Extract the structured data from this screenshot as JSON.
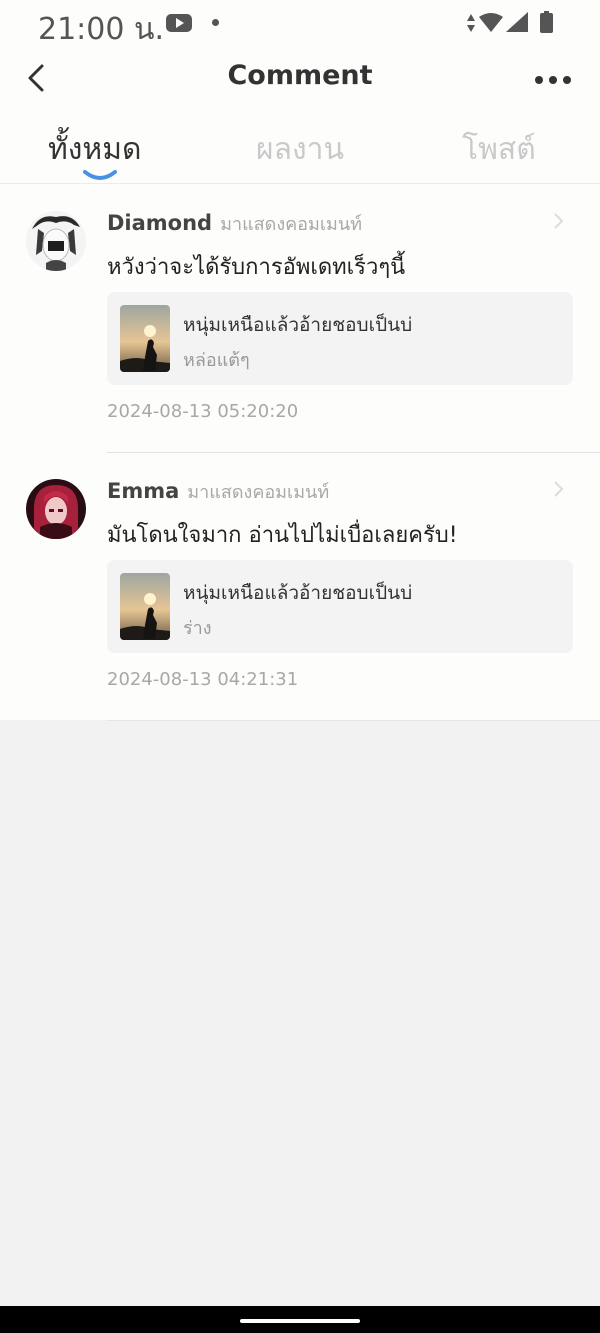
{
  "status_bar": {
    "time": "21:00 น.",
    "icons": [
      "youtube-icon",
      "dot-icon",
      "data-arrows-icon",
      "wifi-icon",
      "signal-icon",
      "battery-icon"
    ]
  },
  "header": {
    "title": "Comment",
    "back_icon": "chevron-left-icon",
    "more_icon": "more-horizontal-icon"
  },
  "tabs": [
    {
      "label": "ทั้งหมด",
      "active": true
    },
    {
      "label": "ผลงาน",
      "active": false
    },
    {
      "label": "โพสต์",
      "active": false
    }
  ],
  "comments": [
    {
      "author": "Diamond",
      "action": "มาแสดงคอมเมนท์",
      "text": "หวังว่าจะได้รับการอัพเดทเร็วๆนี้",
      "work_title": "หนุ่มเหนือแล้วอ้ายชอบเป็นบ่",
      "work_chapter": "หล่อแต้ๆ",
      "time": "2024-08-13 05:20:20"
    },
    {
      "author": "Emma",
      "action": "มาแสดงคอมเมนท์",
      "text": "มันโดนใจมาก อ่านไปไม่เบื่อเลยครับ!",
      "work_title": "หนุ่มเหนือแล้วอ้ายชอบเป็นบ่",
      "work_chapter": "ร่าง",
      "time": "2024-08-13 04:21:31"
    }
  ],
  "colors": {
    "accent": "#4a90e2",
    "background": "#f2f2f2",
    "surface": "#fdfdfc"
  }
}
